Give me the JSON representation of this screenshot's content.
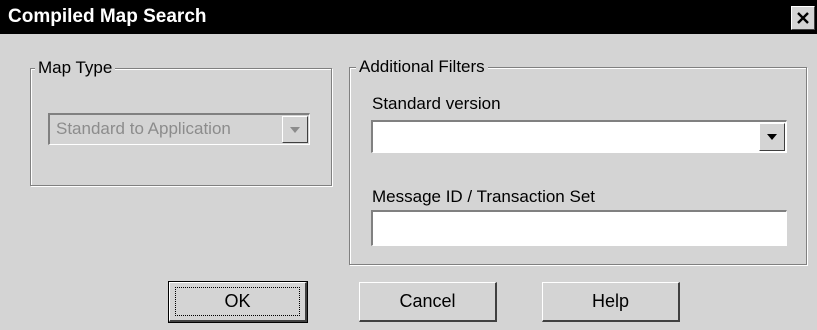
{
  "dialog": {
    "title": "Compiled Map Search",
    "close_icon": "close-icon"
  },
  "map_type_group": {
    "legend": "Map Type",
    "map_type_select": {
      "selected_value": "Standard to Application",
      "enabled": false,
      "arrow_icon": "dropdown-arrow-icon"
    }
  },
  "additional_filters_group": {
    "legend": "Additional Filters",
    "standard_version_label": "Standard version",
    "standard_version_select": {
      "selected_value": "",
      "arrow_icon": "dropdown-arrow-icon"
    },
    "message_id_label": "Message ID / Transaction Set",
    "message_id_value": ""
  },
  "buttons": {
    "ok_label": "OK",
    "cancel_label": "Cancel",
    "help_label": "Help"
  },
  "colors": {
    "dialog_face": "#d4d4d4",
    "titlebar": "#000000",
    "disabled_text": "#8c8c8c"
  }
}
